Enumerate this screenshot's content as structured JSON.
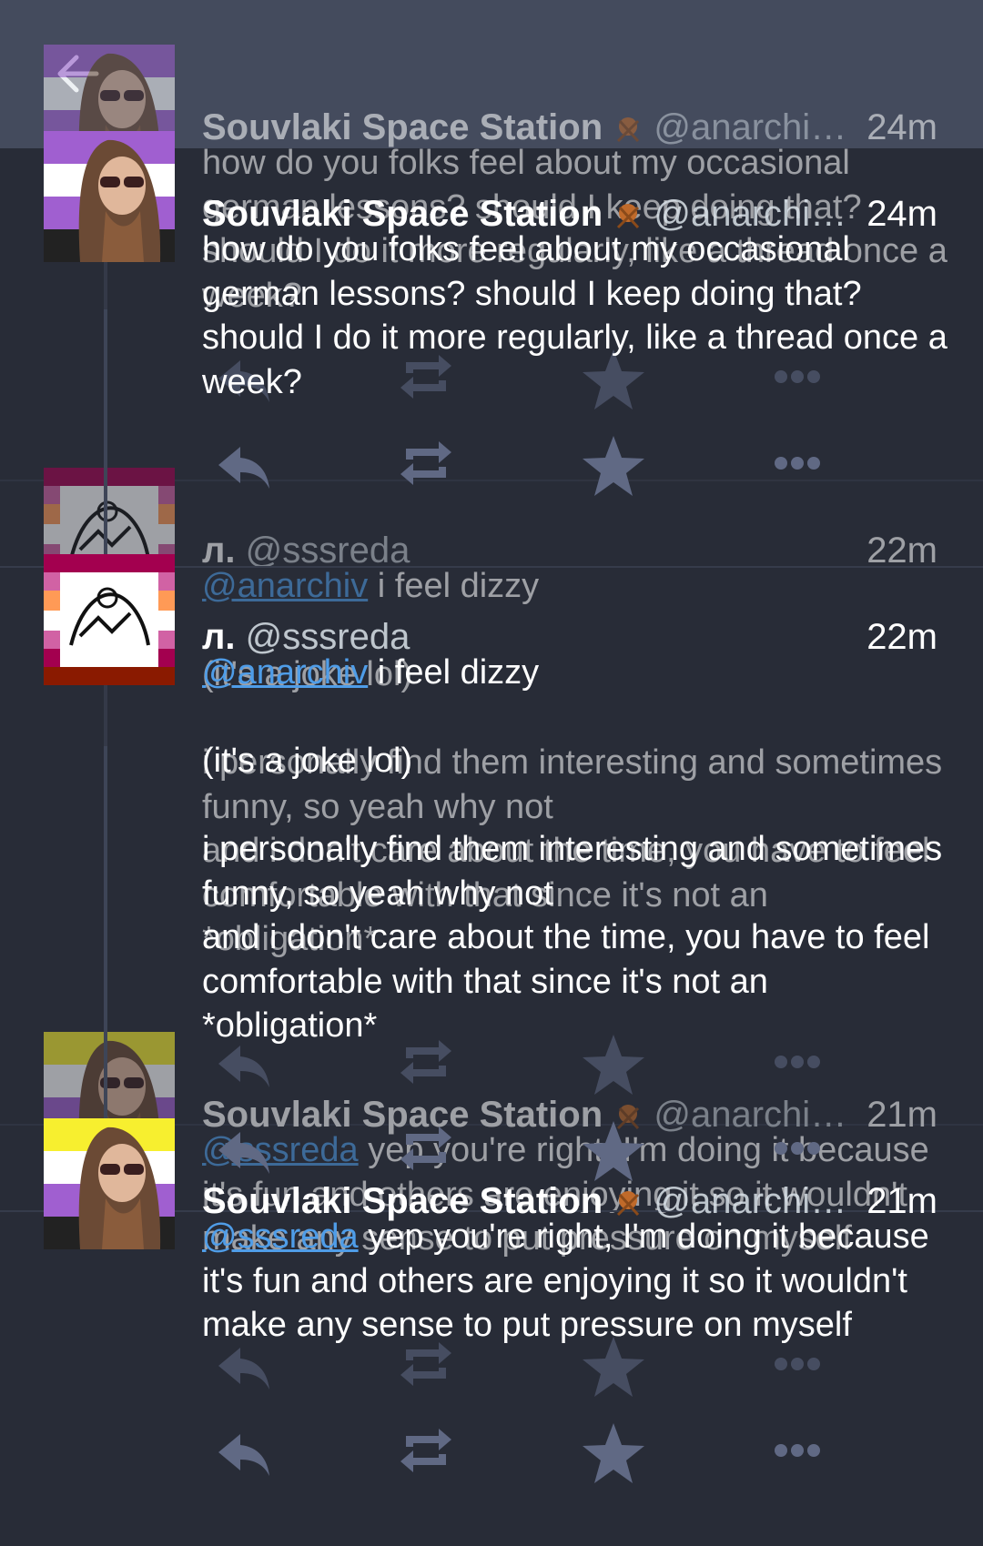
{
  "colors": {
    "topbar": "#444b5d",
    "background": "#282c37",
    "mention": "#4f9de8",
    "action_icon": "#606984"
  },
  "header": {
    "back_icon": "arrow-left-icon"
  },
  "posts": [
    {
      "name": "Souvlaki Space Station",
      "handle": "@anarchi…",
      "time": "24m",
      "mention": "",
      "text": "how do you folks feel about my occasional german lessons? should I keep doing that? should I do it more regularly, like a thread once a week?"
    },
    {
      "name": "л.",
      "handle": "@sssreda",
      "time": "22m",
      "mention": "@anarchiv",
      "text": " i feel dizzy\n\n(it's a joke lol)\n\ni personally find them interesting and sometimes funny, so yeah why not\nand i don't care about the time, you have to feel comfortable with that since it's not an *obligation*"
    },
    {
      "name": "Souvlaki Space Station",
      "handle": "@anarchi…",
      "time": "21m",
      "mention": "@sssreda",
      "text": " yep you're right, I'm doing it because it's fun and others are enjoying it so it wouldn't make any sense to put pressure on myself"
    }
  ],
  "action_icons": [
    "reply-icon",
    "boost-icon",
    "favourite-icon",
    "more-icon"
  ]
}
